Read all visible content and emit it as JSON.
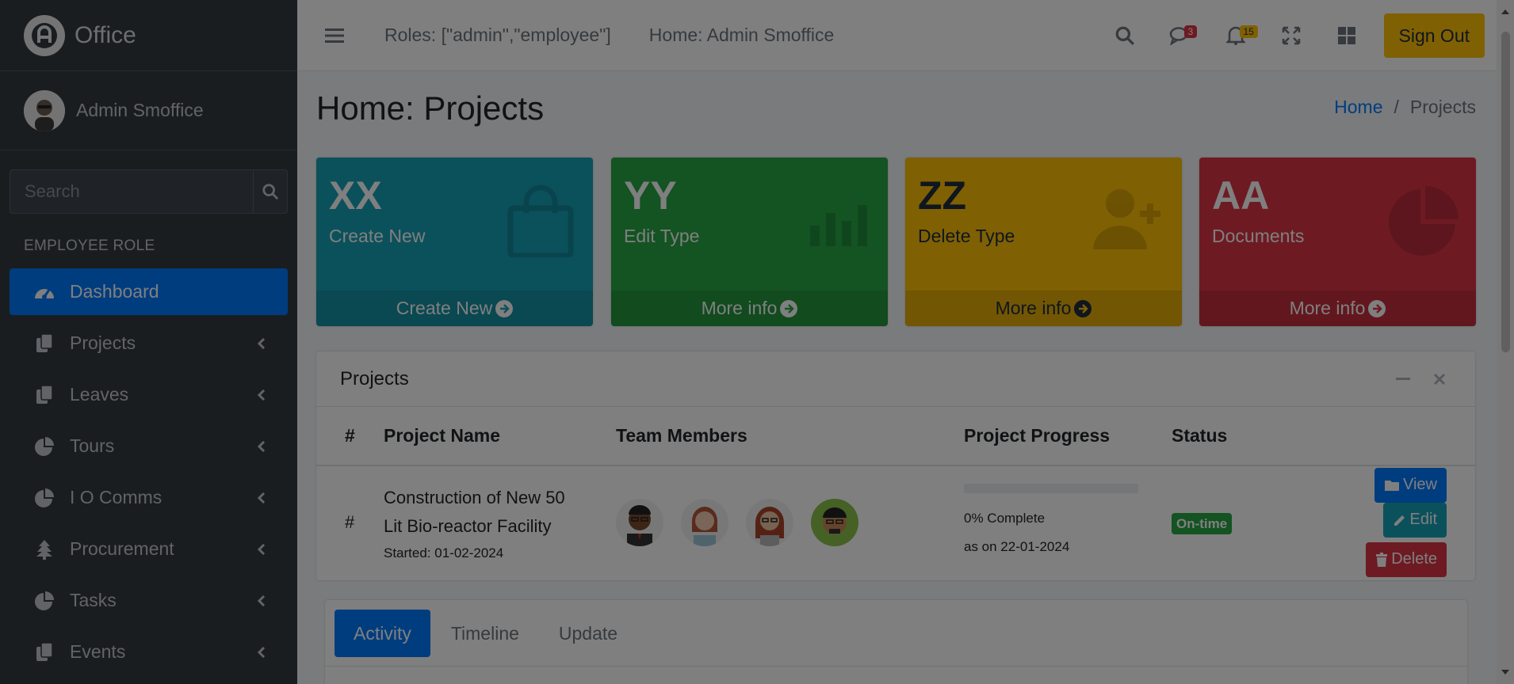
{
  "brand": {
    "name": "Office"
  },
  "user": {
    "name": "Admin Smoffice"
  },
  "sidebar": {
    "search_placeholder": "Search",
    "section_header": "EMPLOYEE ROLE",
    "items": [
      {
        "label": "Dashboard",
        "icon": "tachometer-icon",
        "active": true
      },
      {
        "label": "Projects",
        "icon": "copy-icon"
      },
      {
        "label": "Leaves",
        "icon": "copy-icon"
      },
      {
        "label": "Tours",
        "icon": "pie-chart-icon"
      },
      {
        "label": "I O Comms",
        "icon": "pie-chart-icon"
      },
      {
        "label": "Procurement",
        "icon": "tree-icon"
      },
      {
        "label": "Tasks",
        "icon": "pie-chart-icon"
      },
      {
        "label": "Events",
        "icon": "copy-icon"
      }
    ]
  },
  "topbar": {
    "roles_text": "Roles: [\"admin\",\"employee\"]",
    "home_text": "Home: Admin Smoffice",
    "messages_count": "3",
    "notifications_count": "15",
    "signout_label": "Sign Out"
  },
  "page": {
    "title": "Home: Projects",
    "breadcrumb": {
      "home": "Home",
      "current": "Projects"
    }
  },
  "info_boxes": [
    {
      "value": "XX",
      "label": "Create New",
      "footer": "Create New",
      "color": "#17a2b8"
    },
    {
      "value": "YY",
      "label": "Edit Type",
      "footer": "More info",
      "color": "#28a745"
    },
    {
      "value": "ZZ",
      "label": "Delete Type",
      "footer": "More info",
      "color": "#ffc107"
    },
    {
      "value": "AA",
      "label": "Documents",
      "footer": "More info",
      "color": "#dc3545"
    }
  ],
  "projects": {
    "title": "Projects",
    "columns": [
      "#",
      "Project Name",
      "Team Members",
      "Project Progress",
      "Status"
    ],
    "rows": [
      {
        "index": "#",
        "name_line1": "Construction of New 50",
        "name_line2": "Lit Bio-reactor Facility",
        "started": "Started: 01-02-2024",
        "progress_percent": 0,
        "progress_text": "0% Complete",
        "progress_date": "as on 22-01-2024",
        "status": "On-time",
        "actions": {
          "view": "View",
          "edit": "Edit",
          "delete": "Delete"
        }
      }
    ]
  },
  "tabs": [
    "Activity",
    "Timeline",
    "Update"
  ]
}
